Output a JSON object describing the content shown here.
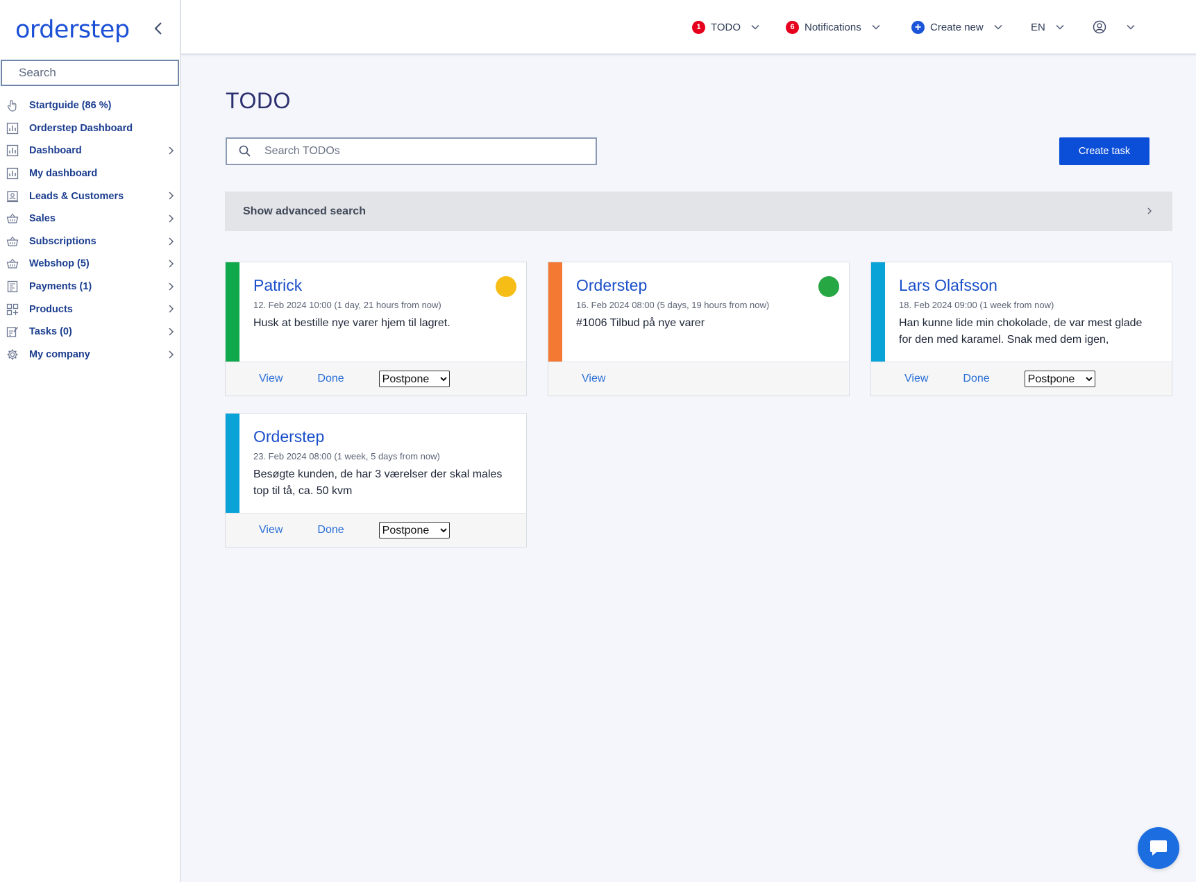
{
  "app": {
    "logo": "orderstep"
  },
  "sidebar": {
    "search_placeholder": "Search",
    "items": [
      {
        "label": "Startguide (86 %)",
        "icon": "hand-pointer-icon",
        "chevron": false
      },
      {
        "label": "Orderstep Dashboard",
        "icon": "chart-icon",
        "chevron": false
      },
      {
        "label": "Dashboard",
        "icon": "chart-icon",
        "chevron": true
      },
      {
        "label": "My dashboard",
        "icon": "chart-icon",
        "chevron": false
      },
      {
        "label": "Leads & Customers",
        "icon": "contact-card-icon",
        "chevron": true
      },
      {
        "label": "Sales",
        "icon": "basket-icon",
        "chevron": true
      },
      {
        "label": "Subscriptions",
        "icon": "basket-icon",
        "chevron": true
      },
      {
        "label": "Webshop (5)",
        "icon": "basket-icon",
        "chevron": true
      },
      {
        "label": "Payments (1)",
        "icon": "invoice-icon",
        "chevron": true
      },
      {
        "label": "Products",
        "icon": "grid-plus-icon",
        "chevron": true
      },
      {
        "label": "Tasks (0)",
        "icon": "checklist-icon",
        "chevron": true
      },
      {
        "label": "My company",
        "icon": "gear-icon",
        "chevron": true
      }
    ]
  },
  "topbar": {
    "todo": {
      "label": "TODO",
      "count": "1"
    },
    "notifications": {
      "label": "Notifications",
      "count": "6"
    },
    "create_new": {
      "label": "Create new"
    },
    "language": {
      "label": "EN"
    }
  },
  "main": {
    "title": "TODO",
    "search_placeholder": "Search TODOs",
    "create_task_label": "Create task",
    "advanced_search_label": "Show advanced search"
  },
  "cards": [
    {
      "name": "Patrick",
      "date": "12. Feb 2024 10:00 (1 day, 21 hours from now)",
      "text": "Husk at bestille nye varer hjem til lagret.",
      "stripe_color": "#0fa84b",
      "status_color": "#f6bd16",
      "actions": {
        "view": "View",
        "done": "Done",
        "postpone": "Postpone"
      }
    },
    {
      "name": "Orderstep",
      "date": "16. Feb 2024 08:00 (5 days, 19 hours from now)",
      "text": "#1006 Tilbud på nye varer",
      "stripe_color": "#f47a33",
      "status_color": "#27a644",
      "actions": {
        "view": "View"
      }
    },
    {
      "name": "Lars Olafsson",
      "date": "18. Feb 2024 09:00 (1 week from now)",
      "text": "Han kunne lide min chokolade, de var mest glade for den med karamel. Snak med dem igen,",
      "stripe_color": "#0aa3d8",
      "actions": {
        "view": "View",
        "done": "Done",
        "postpone": "Postpone"
      }
    },
    {
      "name": "Orderstep",
      "date": "23. Feb 2024 08:00 (1 week, 5 days from now)",
      "text": "Besøgte kunden, de har 3 værelser der skal males top til tå, ca. 50 kvm",
      "stripe_color": "#0aa3d8",
      "actions": {
        "view": "View",
        "done": "Done",
        "postpone": "Postpone"
      }
    }
  ],
  "colors": {
    "brand": "#1a4fd6",
    "primary_button": "#0b4ed8",
    "badge": "#e6001e"
  }
}
